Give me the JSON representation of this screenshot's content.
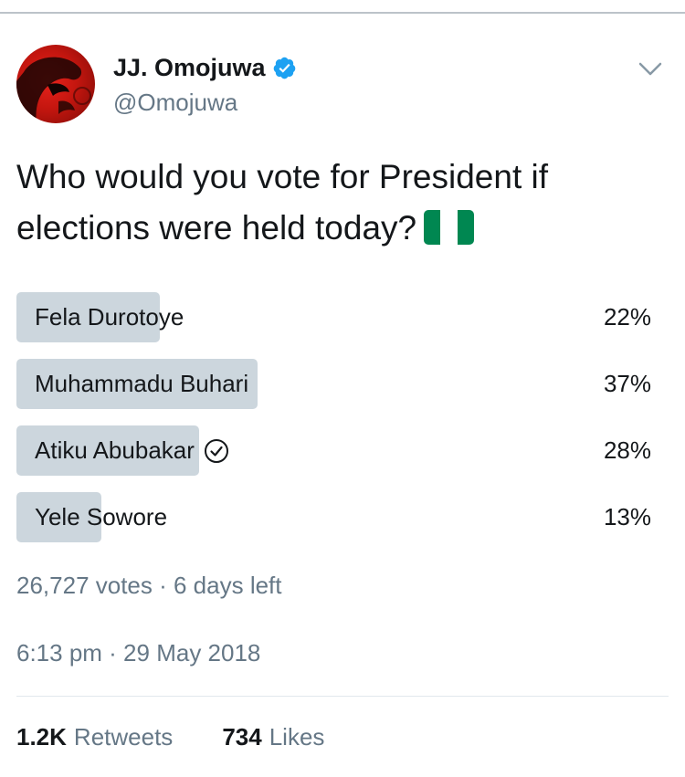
{
  "author": {
    "display_name": "JJ. Omojuwa",
    "handle": "@Omojuwa",
    "verified": true
  },
  "tweet": {
    "text": "Who would you vote for President if elections were held today?",
    "flag_icon": "nigeria-flag-icon",
    "flag_colors": [
      "#008751",
      "#ffffff",
      "#008751"
    ]
  },
  "poll": {
    "options": [
      {
        "label": "Fela Durotoye",
        "percent_text": "22%",
        "percent": 22,
        "chosen": false
      },
      {
        "label": "Muhammadu Buhari",
        "percent_text": "37%",
        "percent": 37,
        "chosen": false
      },
      {
        "label": "Atiku Abubakar",
        "percent_text": "28%",
        "percent": 28,
        "chosen": true
      },
      {
        "label": "Yele Sowore",
        "percent_text": "13%",
        "percent": 13,
        "chosen": false
      }
    ],
    "meta": "26,727 votes · 6 days left",
    "bar_color": "#ccd6dd"
  },
  "timestamp": "6:13 pm · 29 May 2018",
  "stats": {
    "retweets_count": "1.2K",
    "retweets_label": "Retweets",
    "likes_count": "734",
    "likes_label": "Likes"
  },
  "colors": {
    "text": "#14171a",
    "secondary": "#657786",
    "verified_blue": "#1da1f2"
  }
}
